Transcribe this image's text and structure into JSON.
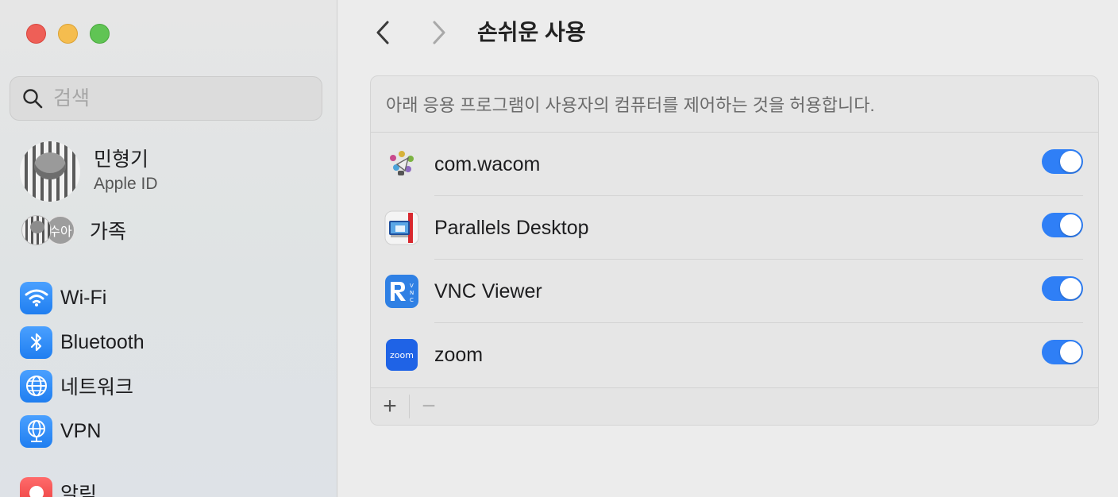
{
  "sidebar": {
    "search_placeholder": "검색",
    "profile": {
      "name": "민형기",
      "subtitle": "Apple ID"
    },
    "family": {
      "badge": "수아",
      "label": "가족"
    },
    "items": [
      {
        "label": "Wi-Fi",
        "icon": "wifi-icon"
      },
      {
        "label": "Bluetooth",
        "icon": "bluetooth-icon"
      },
      {
        "label": "네트워크",
        "icon": "globe-icon"
      },
      {
        "label": "VPN",
        "icon": "vpn-globe-icon"
      },
      {
        "label": "알림",
        "icon": "notifications-icon"
      }
    ]
  },
  "header": {
    "title": "손쉬운 사용"
  },
  "panel": {
    "description": "아래 응용 프로그램이 사용자의 컴퓨터를 제어하는 것을 허용합니다.",
    "apps": [
      {
        "name": "com.wacom",
        "enabled": true,
        "icon": "wacom-icon"
      },
      {
        "name": "Parallels Desktop",
        "enabled": true,
        "icon": "parallels-icon"
      },
      {
        "name": "VNC Viewer",
        "enabled": true,
        "icon": "vnc-viewer-icon"
      },
      {
        "name": "zoom",
        "enabled": true,
        "icon": "zoom-icon"
      }
    ],
    "add_label": "+",
    "remove_label": "−"
  },
  "colors": {
    "accent": "#2f7ff6",
    "close": "#ee5f57",
    "minimize": "#f5bd4f",
    "zoom": "#60c454"
  }
}
